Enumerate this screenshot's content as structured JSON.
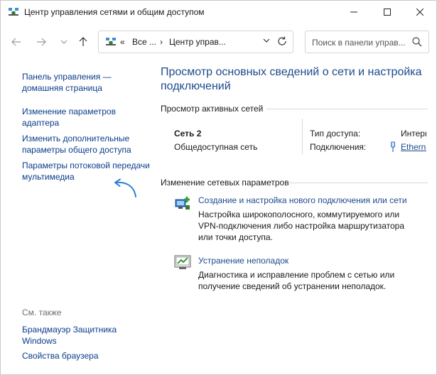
{
  "window": {
    "title": "Центр управления сетями и общим доступом"
  },
  "address": {
    "separator1": "«",
    "crumb1": "Все ...",
    "separator2": "›",
    "crumb2": "Центр управ..."
  },
  "search": {
    "placeholder": "Поиск в панели управ..."
  },
  "sidebar": {
    "home_link": "Панель управления — домашняя страница",
    "adapter_link": "Изменение параметров адаптера",
    "sharing_link": "Изменить дополнительные параметры общего доступа",
    "streaming_link": "Параметры потоковой передачи мультимедиа",
    "see_also": "См. также",
    "firewall_link": "Брандмауэр Защитника Windows",
    "browser_link": "Свойства браузера"
  },
  "main": {
    "title": "Просмотр основных сведений о сети и настройка подключений",
    "active_header": "Просмотр активных сетей",
    "network": {
      "name": "Сеть 2",
      "type": "Общедоступная сеть",
      "access_label": "Тип доступа:",
      "access_value": "Интернет",
      "connections_label": "Подключения:",
      "connections_value": "Ethernet"
    },
    "change_header": "Изменение сетевых параметров",
    "tasks": [
      {
        "icon": "new-connection-icon",
        "link": "Создание и настройка нового подключения или сети",
        "description": "Настройка широкополосного, коммутируемого или VPN-подключения либо настройка маршрутизатора или точки доступа."
      },
      {
        "icon": "troubleshoot-icon",
        "link": "Устранение неполадок",
        "description": "Диагностика и исправление проблем с сетью или получение сведений об устранении неполадок."
      }
    ]
  },
  "colors": {
    "link": "#1e4a8e",
    "annotation_arrow": "#2a7fd4"
  }
}
